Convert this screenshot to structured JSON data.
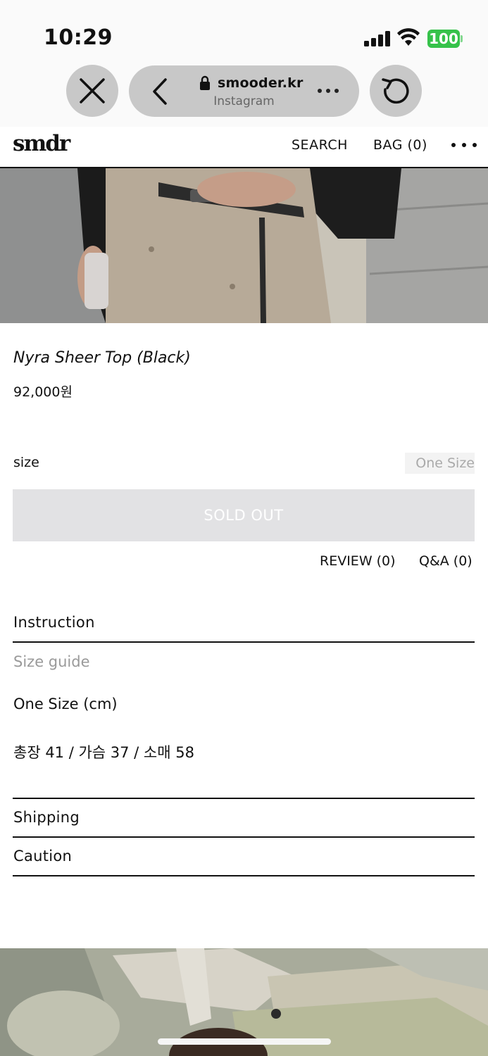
{
  "status_bar": {
    "time": "10:29",
    "battery": "100",
    "battery_color": "#36c24a"
  },
  "browser": {
    "host": "smooder.kr",
    "subtitle": "Instagram",
    "icons": [
      "close-icon",
      "back-chevron-icon",
      "lock-icon",
      "more-icon",
      "reload-icon"
    ]
  },
  "header": {
    "logo": "smdr",
    "search_label": "SEARCH",
    "bag_label": "BAG (0)"
  },
  "product": {
    "name": "Nyra Sheer Top (Black)",
    "price": "92,000원",
    "size_label": "size",
    "size_option": "One Size",
    "sold_out_label": "SOLD OUT",
    "review_label": "REVIEW (0)",
    "qna_label": "Q&A (0)"
  },
  "sections": {
    "instruction": "Instruction",
    "size_guide": "Size guide",
    "size_unit": "One Size (cm)",
    "measurements": "총장 41 / 가슴 37 / 소매 58",
    "shipping": "Shipping",
    "caution": "Caution"
  }
}
